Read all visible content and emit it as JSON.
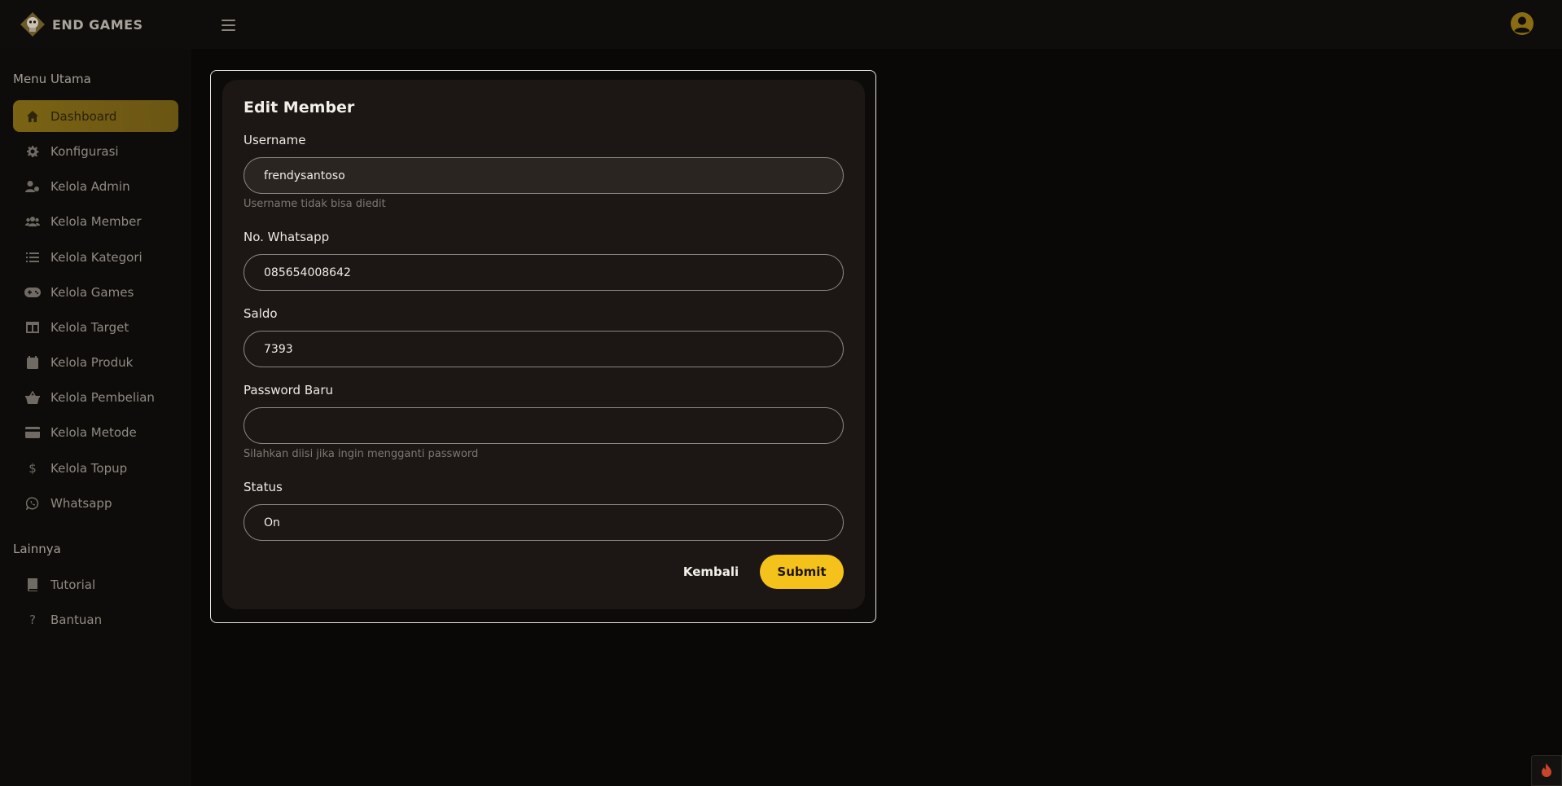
{
  "brand": {
    "name": "END GAMES"
  },
  "colors": {
    "accent": "#f5c21c",
    "active_menu": "#7a6313",
    "background": "#0a0806",
    "card": "#1c1714"
  },
  "sidebar": {
    "sections": [
      {
        "title": "Menu Utama",
        "items": [
          {
            "label": "Dashboard",
            "icon": "home-icon",
            "active": true
          },
          {
            "label": "Konfigurasi",
            "icon": "gear-icon"
          },
          {
            "label": "Kelola Admin",
            "icon": "user-cog-icon"
          },
          {
            "label": "Kelola Member",
            "icon": "users-icon"
          },
          {
            "label": "Kelola Kategori",
            "icon": "list-icon"
          },
          {
            "label": "Kelola Games",
            "icon": "gamepad-icon"
          },
          {
            "label": "Kelola Target",
            "icon": "table-icon"
          },
          {
            "label": "Kelola Produk",
            "icon": "calendar-icon"
          },
          {
            "label": "Kelola Pembelian",
            "icon": "basket-icon"
          },
          {
            "label": "Kelola Metode",
            "icon": "credit-card-icon"
          },
          {
            "label": "Kelola Topup",
            "icon": "dollar-icon"
          },
          {
            "label": "Whatsapp",
            "icon": "whatsapp-icon"
          }
        ]
      },
      {
        "title": "Lainnya",
        "items": [
          {
            "label": "Tutorial",
            "icon": "book-icon"
          },
          {
            "label": "Bantuan",
            "icon": "question-icon"
          }
        ]
      }
    ]
  },
  "form": {
    "title": "Edit Member",
    "username": {
      "label": "Username",
      "value": "frendysantoso",
      "help": "Username tidak bisa diedit"
    },
    "whatsapp": {
      "label": "No. Whatsapp",
      "value": "085654008642"
    },
    "saldo": {
      "label": "Saldo",
      "value": "7393"
    },
    "password": {
      "label": "Password Baru",
      "value": "",
      "help": "Silahkan diisi jika ingin mengganti password"
    },
    "status": {
      "label": "Status",
      "value": "On"
    },
    "back_label": "Kembali",
    "submit_label": "Submit"
  }
}
